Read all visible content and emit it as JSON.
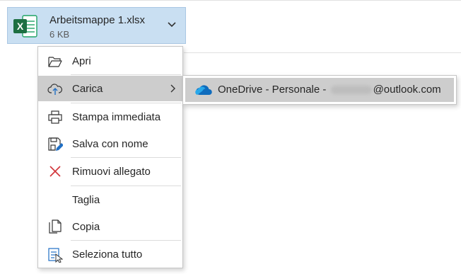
{
  "attachment": {
    "filename": "Arbeitsmappe 1.xlsx",
    "size": "6 KB",
    "icon": "excel-file-icon",
    "icon_letter": "X",
    "accent": "#1d6f42"
  },
  "menu": {
    "items": [
      {
        "label": "Apri",
        "icon": "open-folder-icon"
      },
      {
        "label": "Carica",
        "icon": "cloud-upload-icon",
        "submenu": true
      },
      {
        "label": "Stampa immediata",
        "icon": "printer-icon"
      },
      {
        "label": "Salva con nome",
        "icon": "save-as-icon"
      },
      {
        "label": "Rimuovi allegato",
        "icon": "remove-x-icon"
      },
      {
        "label": "Taglia",
        "icon": ""
      },
      {
        "label": "Copia",
        "icon": "copy-icon"
      },
      {
        "label": "Seleziona tutto",
        "icon": "select-all-icon"
      }
    ]
  },
  "submenu": {
    "prefix": "OneDrive - Personale - ",
    "suffix": "@outlook.com",
    "icon": "onedrive-cloud-icon"
  }
}
